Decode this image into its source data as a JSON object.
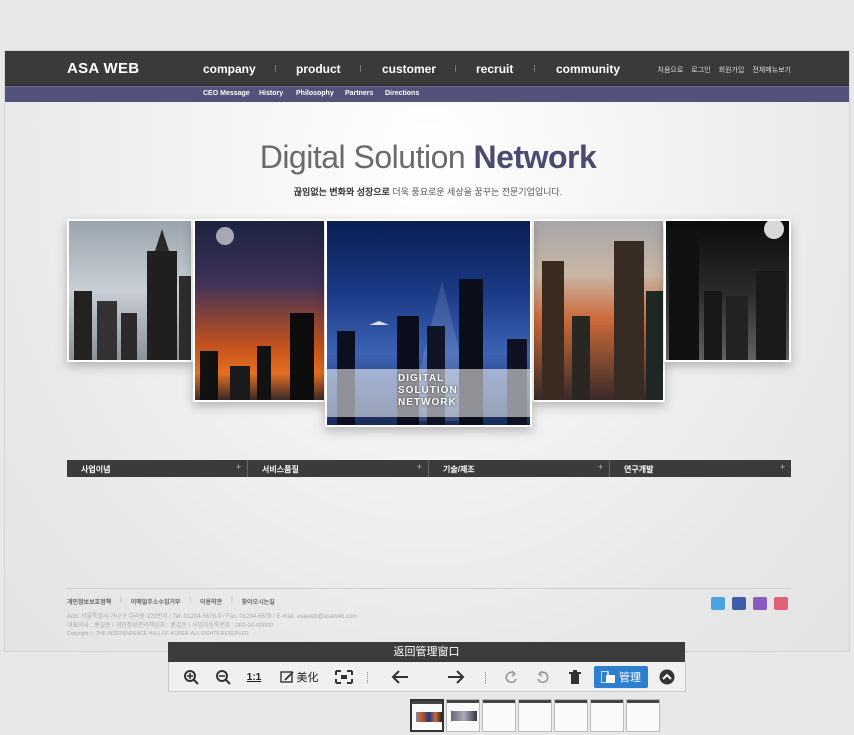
{
  "site": {
    "logo": "ASA WEB",
    "nav": [
      "company",
      "product",
      "customer",
      "recruit",
      "community"
    ],
    "util": [
      "처음으로",
      "로그인",
      "회원가입",
      "전체메뉴보기"
    ],
    "subnav": [
      "CEO Message",
      "History",
      "Philosophy",
      "Partners",
      "Directions"
    ]
  },
  "hero": {
    "title_light": "Digital Solution",
    "title_bold": "Network",
    "subtitle_bold": "끊임없는 변화와 성장으로",
    "subtitle_rest": " 더욱 풍요로운 세상을 꿈꾸는 전문기업입니다.",
    "panel_label": [
      "DIGITAL",
      "SOLUTION",
      "NETWORK"
    ]
  },
  "tabs": [
    {
      "label": "사업이념",
      "plus": "+"
    },
    {
      "label": "서비스품질",
      "plus": "+"
    },
    {
      "label": "기술/제조",
      "plus": "+"
    },
    {
      "label": "연구개발",
      "plus": "+"
    }
  ],
  "footer": {
    "links": [
      "개인정보보호정책",
      "이메일주소수집거부",
      "이용약관",
      "찾아오시는길"
    ],
    "link_sep": "|",
    "address": "Add. 서울특별시 가나구 다라동 123번지  /  Tel. 01234-5678-9  /  Fax. 01234-5678  /  E-mail. asaweb@asaweb.com",
    "ceo": "대표이사 : 홍길동  /  개인정보관리책임자 : 홍길순  /  사업자등록번호 : 000-00-00000",
    "copyright": "Copyright ⓒ THE INDEPENDENCE HALL OF KOREA. ALL RIGHTS RESERVED."
  },
  "sns": [
    {
      "icon": "twitter-icon",
      "color": "#4aa3df"
    },
    {
      "icon": "facebook-icon",
      "color": "#3b5fa8"
    },
    {
      "icon": "instagram-icon",
      "color": "#8a5bbf"
    },
    {
      "icon": "youtube-icon",
      "color": "#e0607a"
    }
  ],
  "viewer": {
    "title": "返回管理窗口",
    "fit_label": "1:1",
    "beautify_label": "美化",
    "manage_label": "管理",
    "accent": "#2f7fd1"
  },
  "thumbnails_count": 7
}
